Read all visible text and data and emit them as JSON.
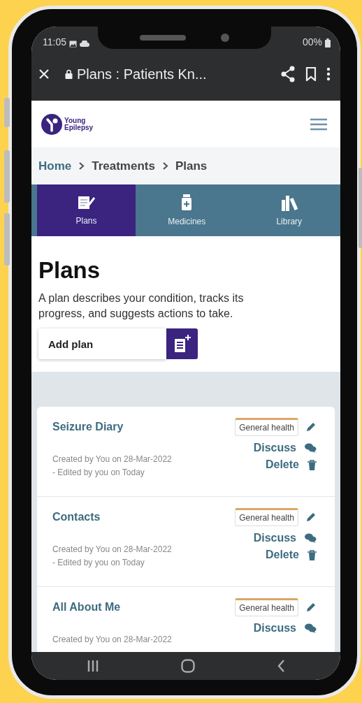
{
  "status_bar": {
    "time": "11:05",
    "battery": "00%"
  },
  "browser_bar": {
    "title": "Plans : Patients Kn..."
  },
  "header": {
    "logo_text": [
      "Young",
      "Epilepsy"
    ]
  },
  "breadcrumb": [
    "Home",
    "Treatments",
    "Plans"
  ],
  "tabs": [
    {
      "label": "Plans",
      "selected": true
    },
    {
      "label": "Medicines",
      "selected": false
    },
    {
      "label": "Library",
      "selected": false
    }
  ],
  "page": {
    "title": "Plans",
    "description": "A plan describes your condition, tracks its progress, and suggests actions to take.",
    "add_button": "Add plan"
  },
  "plans": [
    {
      "title": "Seizure Diary",
      "tag": "General health",
      "created": "Created by You on 28-Mar-2022",
      "edited": "- Edited by you on Today",
      "discuss": "Discuss",
      "delete": "Delete"
    },
    {
      "title": "Contacts",
      "tag": "General health",
      "created": "Created by You on 28-Mar-2022",
      "edited": "- Edited by you on Today",
      "discuss": "Discuss",
      "delete": "Delete"
    },
    {
      "title": "All About Me",
      "tag": "General health",
      "created": "Created by You on 28-Mar-2022",
      "discuss": "Discuss"
    }
  ]
}
